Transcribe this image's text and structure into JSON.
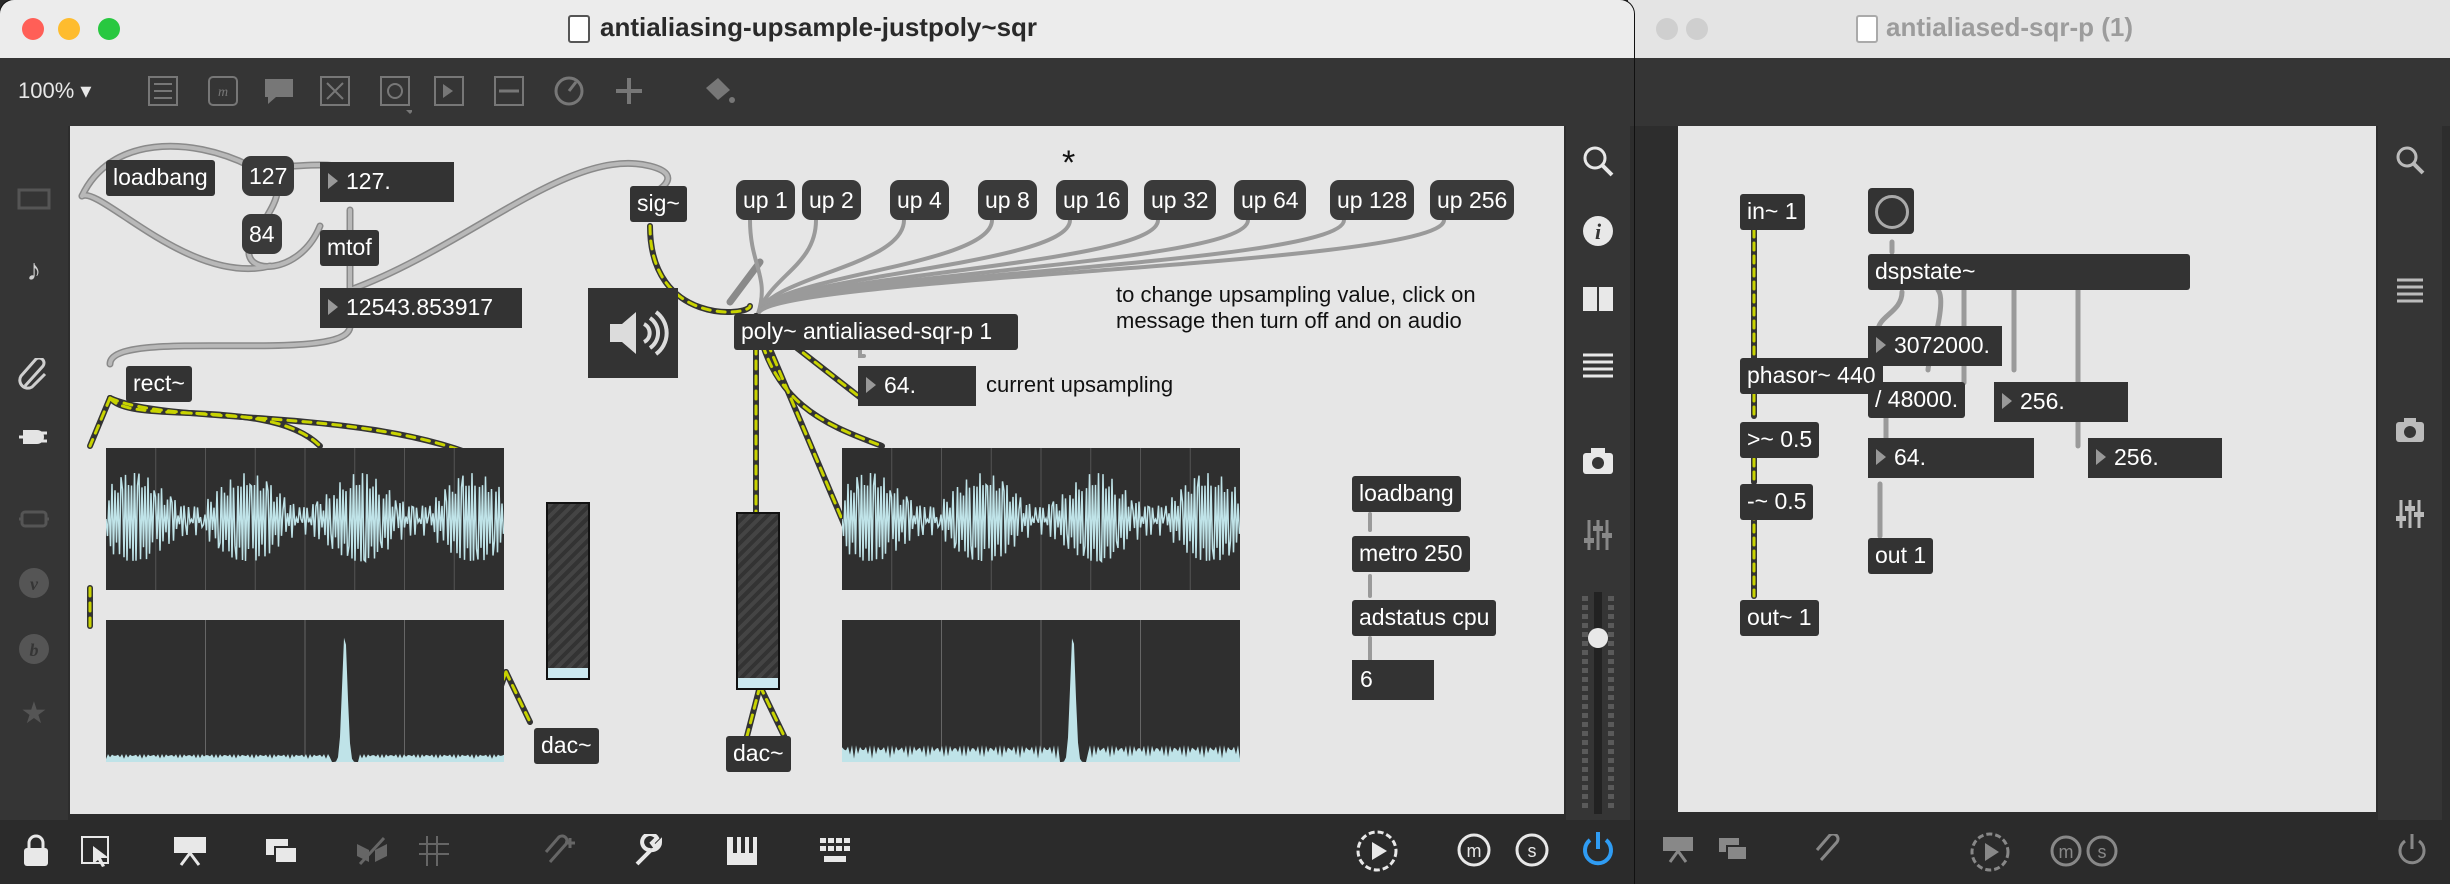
{
  "main_window": {
    "title": "antialiasing-upsample-justpoly~sqr",
    "zoom": "100%",
    "objects": {
      "loadbang": "loadbang",
      "msg_127": "127",
      "msg_84": "84",
      "num_127": "127.",
      "mtof": "mtof",
      "freq": "12543.853917",
      "sig": "sig~",
      "rect": "rect~",
      "poly": "poly~ antialiased-sqr-p 1",
      "upsampling_num": "64.",
      "upsampling_label": "current upsampling",
      "instructions_line1": "to change upsampling value, click on",
      "instructions_line2": "message then turn off and on audio",
      "asterisk": "*",
      "dac_left": "dac~",
      "dac_right": "dac~",
      "loadbang2": "loadbang",
      "metro": "metro 250",
      "adstatus": "adstatus cpu",
      "cpu_value": "6"
    },
    "up_messages": [
      "up 1",
      "up 2",
      "up 4",
      "up 8",
      "up 16",
      "up 32",
      "up 64",
      "up 128",
      "up 256"
    ],
    "left_sidebar_icons": [
      "presentation-icon",
      "music-note-icon",
      "paperclip-icon",
      "plug-icon",
      "device-icon",
      "v-icon",
      "b-icon",
      "star-icon"
    ],
    "right_sidebar_icons": [
      "search-icon",
      "info-icon",
      "book-icon",
      "list-icon",
      "camera-icon",
      "mixer-icon"
    ],
    "bottom_icons": [
      "lock-icon",
      "edit-icon",
      "presentation-icon",
      "windows-icon",
      "hide-icon",
      "grid-icon",
      "attach-icon",
      "wrench-icon",
      "piano-icon",
      "keyboard-icon"
    ]
  },
  "second_window": {
    "title": "antialiased-sqr-p (1)",
    "objects": {
      "in": "in~ 1",
      "phasor": "phasor~ 440",
      "gte": ">~ 0.5",
      "minus": "-~ 0.5",
      "out_sig": "out~ 1",
      "dspstate": "dspstate~",
      "num_sr": "3072000.",
      "div": "/ 48000.",
      "num_64": "64.",
      "num_256a": "256.",
      "num_256b": "256.",
      "out_ctl": "out 1"
    }
  },
  "colors": {
    "canvas": "#e6e6e6",
    "object": "#333333",
    "patchcord_signal": "#c8d300",
    "patchcord_control": "#9a9a9a",
    "scope_wave": "#bfe3e8",
    "power_on": "#2f9cf3"
  }
}
